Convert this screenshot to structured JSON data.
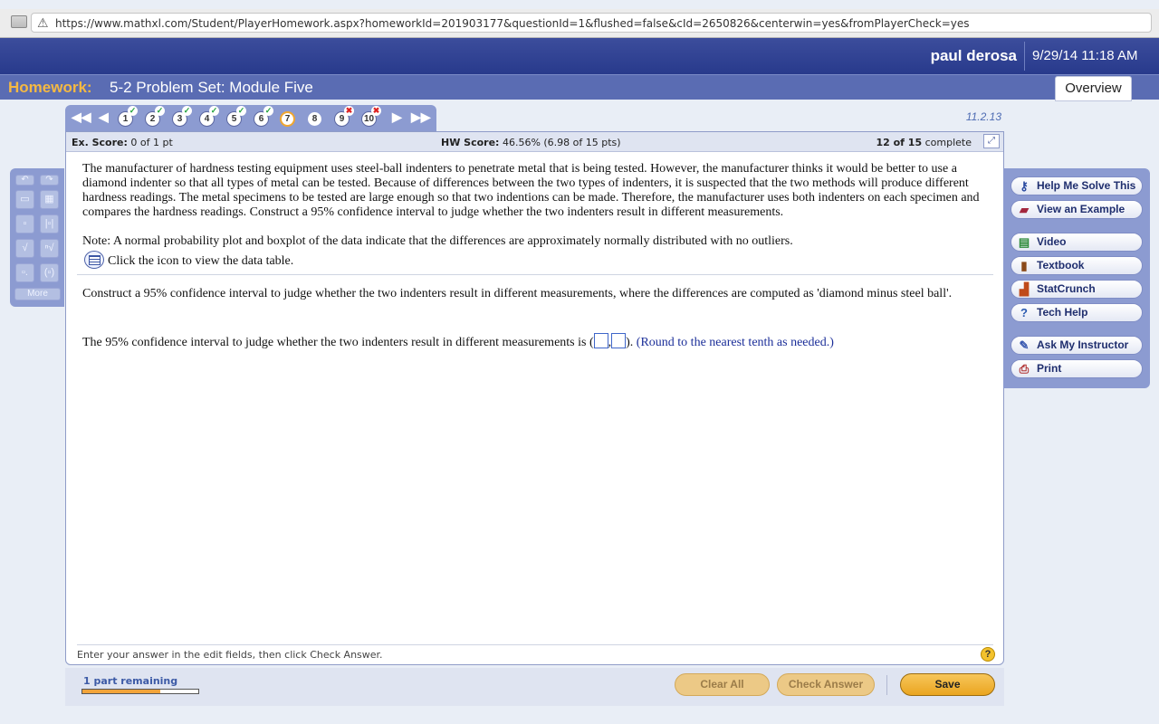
{
  "browser": {
    "url": "https://www.mathxl.com/Student/PlayerHomework.aspx?homeworkId=201903177&questionId=1&flushed=false&cId=2650826&centerwin=yes&fromPlayerCheck=yes"
  },
  "header": {
    "user_name": "paul derosa",
    "datetime": "9/29/14 11:18 AM",
    "homework_label": "Homework:",
    "homework_title": "5-2 Problem Set: Module Five",
    "overview_label": "Overview"
  },
  "question_nav": {
    "first": "◀◀",
    "prev": "◀",
    "next": "▶",
    "last": "▶▶",
    "questions": [
      {
        "number": "1",
        "status": "correct"
      },
      {
        "number": "2",
        "status": "correct"
      },
      {
        "number": "3",
        "status": "correct"
      },
      {
        "number": "4",
        "status": "partial"
      },
      {
        "number": "5",
        "status": "correct"
      },
      {
        "number": "6",
        "status": "correct"
      },
      {
        "number": "7",
        "status": "current"
      },
      {
        "number": "8",
        "status": "unanswered"
      },
      {
        "number": "9",
        "status": "incorrect"
      },
      {
        "number": "10",
        "status": "incorrect"
      }
    ],
    "version": "11.2.13"
  },
  "scores": {
    "ex_score_label": "Ex. Score:",
    "ex_score_value": "0 of 1 pt",
    "hw_score_label": "HW Score:",
    "hw_score_value": "46.56% (6.98 of 15 pts)",
    "progress_bold": "12 of 15",
    "progress_text": "complete"
  },
  "question": {
    "problem": "The manufacturer of hardness testing equipment uses steel-ball indenters to penetrate metal that is being tested. However, the manufacturer thinks it would be better to use a diamond indenter so that all types of metal can be tested. Because of differences between the two types of indenters, it is suspected that the two methods will produce different hardness readings. The metal specimens to be tested are large enough so that two indentions can be made. Therefore, the manufacturer uses both indenters on each specimen and compares the hardness readings. Construct a 95% confidence interval to judge whether the two indenters result in different measurements.",
    "note": "Note: A normal probability plot and boxplot of the data indicate that the differences are approximately normally distributed with no outliers.",
    "data_link": "Click the icon to view the data table.",
    "construct": "Construct a 95% confidence interval to judge whether the two indenters result in different measurements, where the differences are computed as 'diamond minus steel ball'.",
    "answer_prefix": "The 95% confidence interval to judge whether the two indenters result in different measurements is (",
    "answer_comma": ",",
    "answer_suffix": ").",
    "round_hint": "(Round to the nearest tenth as needed.)"
  },
  "footer": {
    "instruction": "Enter your answer in the edit fields, then click Check Answer.",
    "help_glyph": "?"
  },
  "palette": {
    "more_label": "More"
  },
  "helpers": [
    {
      "label": "Help Me Solve This",
      "icon": "key-icon",
      "glyph": "⚷"
    },
    {
      "label": "View an Example",
      "icon": "binoculars-icon",
      "glyph": "▰"
    },
    {
      "label": "Video",
      "icon": "film-icon",
      "glyph": "▤"
    },
    {
      "label": "Textbook",
      "icon": "book-icon",
      "glyph": "▮"
    },
    {
      "label": "StatCrunch",
      "icon": "statcrunch-icon",
      "glyph": "▟"
    },
    {
      "label": "Tech Help",
      "icon": "question-icon",
      "glyph": "?"
    },
    {
      "label": "Ask My Instructor",
      "icon": "person-icon",
      "glyph": "✎"
    },
    {
      "label": "Print",
      "icon": "printer-icon",
      "glyph": "⎙"
    }
  ],
  "bottom": {
    "parts_remaining": "1 part remaining",
    "parts_progress": 0.67,
    "clear_all": "Clear All",
    "check_answer": "Check Answer",
    "save": "Save"
  },
  "colors": {
    "header_blue": "#283a8c",
    "title_blue": "#5a6cb3",
    "homework_orange": "#f5b942",
    "panel_lilac": "#8c9bd1",
    "save_gold": "#eaa520"
  }
}
